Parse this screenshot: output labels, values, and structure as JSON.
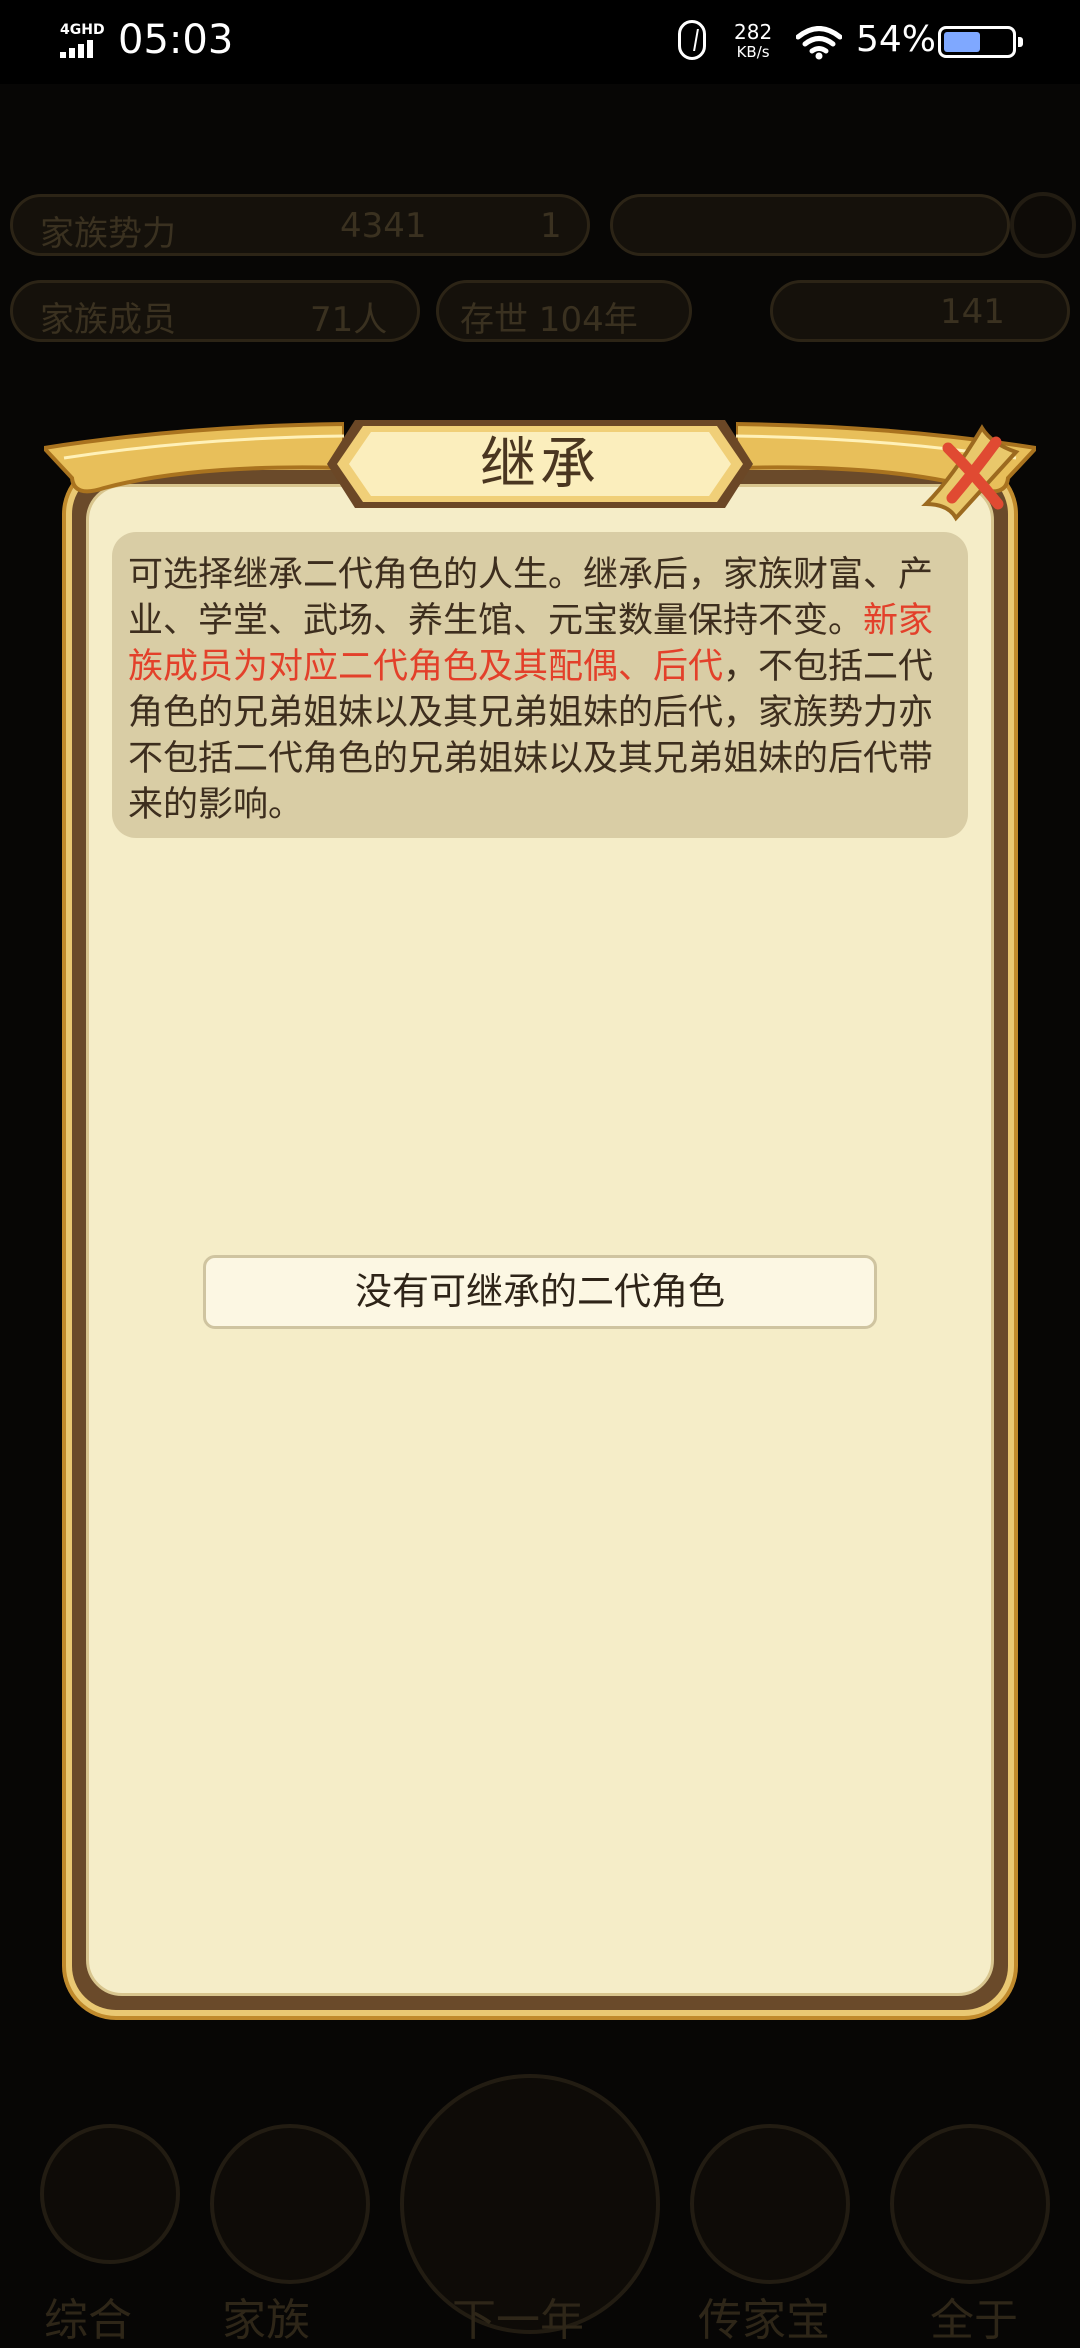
{
  "status_bar": {
    "network": "4GHD",
    "time": "05:03",
    "speed_value": "282",
    "speed_unit": "KB/s",
    "battery": "54%",
    "battery_level": 0.54
  },
  "background": {
    "row1_left": "家族势力",
    "row1_mid": "4341",
    "row1_right": "1",
    "row2_left": "家族成员",
    "row2_mid": "71人",
    "row2_right": "存世 104年",
    "row2_far": "141",
    "tabs": [
      "综合",
      "家族",
      "下一年",
      "传家宝",
      "全于"
    ]
  },
  "dialog": {
    "title": "继承",
    "info_part1": "可选择继承二代角色的人生。继承后，家族财富、产业、学堂、武场、养生馆、元宝数量保持不变。",
    "info_highlight": "新家族成员为对应二代角色及其配偶、后代",
    "info_part2": "，不包括二代角色的兄弟姐妹以及其兄弟姐妹的后代，家族势力亦不包括二代角色的兄弟姐妹以及其兄弟姐妹的后代带来的影响。",
    "empty_message": "没有可继承的二代角色"
  },
  "colors": {
    "highlight": "#e3402a",
    "panel": "#f5edc8",
    "gold": "#e9c873"
  }
}
